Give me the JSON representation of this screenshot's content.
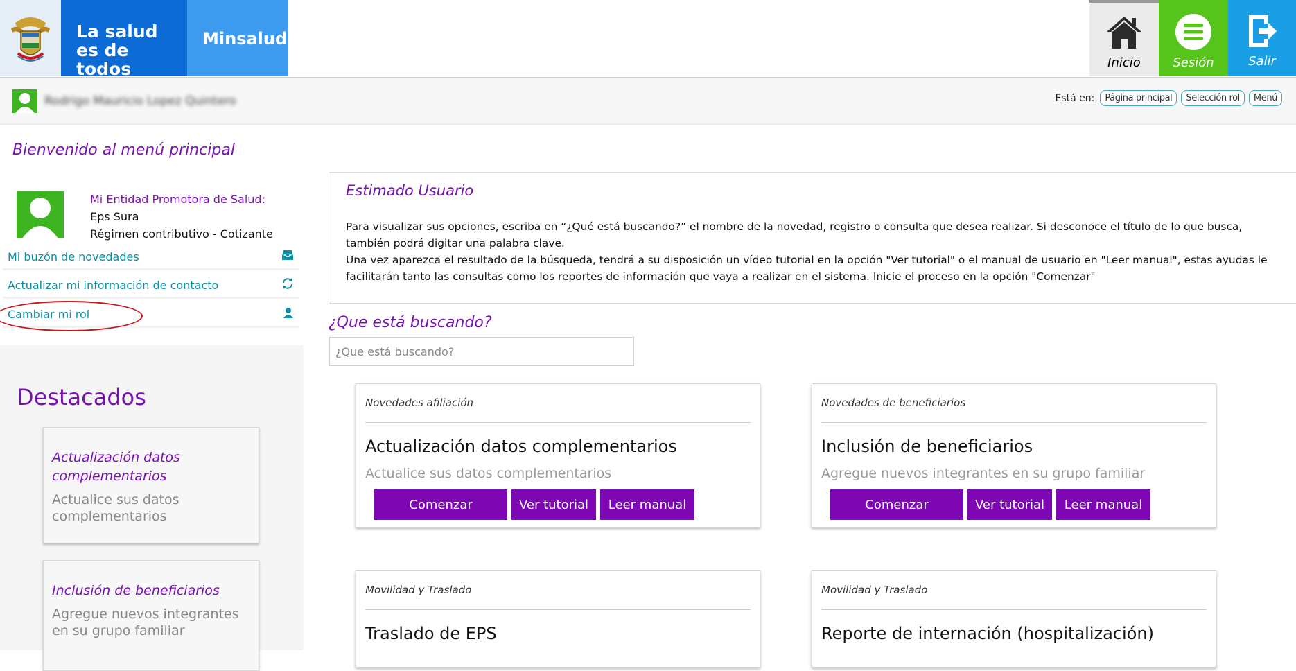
{
  "header": {
    "brand_line1": "La salud",
    "brand_line2": "es de todos",
    "brand_ministry": "Minsalud",
    "buttons": {
      "home": "Inicio",
      "session": "Sesión",
      "exit": "Salir"
    },
    "colors": {
      "blue": "#0d6bd6",
      "light_blue": "#3d9bf0",
      "green": "#57c41b",
      "exit_blue": "#1a9ee5"
    }
  },
  "userbar": {
    "user_name": "Rodrigo Mauricio Lopez Quintero",
    "breadcrumb_label": "Está en:",
    "breadcrumbs": [
      "Página principal",
      "Selección rol",
      "Menú"
    ]
  },
  "welcome": "Bienvenido al menú principal",
  "profile": {
    "eps_title": "Mi Entidad Promotora de Salud:",
    "eps_name": "Eps Sura",
    "regime": "Régimen contributivo - Cotizante",
    "links": [
      {
        "label": "Mi buzón de novedades",
        "icon": "inbox-icon"
      },
      {
        "label": "Actualizar mi información de contacto",
        "icon": "refresh-icon"
      },
      {
        "label": "Cambiar mi rol",
        "icon": "user-icon"
      }
    ]
  },
  "destacados": {
    "title": "Destacados",
    "items": [
      {
        "title": "Actualización datos complementarios",
        "desc": "Actualice sus datos complementarios"
      },
      {
        "title": "Inclusión de beneficiarios",
        "desc": "Agregue nuevos integrantes en su grupo familiar"
      }
    ]
  },
  "info": {
    "title": "Estimado Usuario",
    "p1": "Para visualizar sus opciones, escriba en “¿Qué está buscando?” el nombre de la novedad, registro o consulta que desea realizar. Si desconoce el título de lo que busca, también podrá digitar una palabra clave.",
    "p2": "Una vez aparezca el resultado de la búsqueda, tendrá a su disposición un vídeo tutorial en la opción \"Ver tutorial\" o el manual de usuario en \"Leer manual\", estas ayudas le facilitarán tanto las consultas como los reportes de información que vaya a realizar en el sistema. Inicie el proceso en la opción \"Comenzar\""
  },
  "search": {
    "label": "¿Que está buscando?",
    "placeholder": "¿Que está buscando?"
  },
  "cards": [
    {
      "category": "Novedades afiliación",
      "title": "Actualización datos complementarios",
      "desc": "Actualice sus datos complementarios"
    },
    {
      "category": "Novedades de beneficiarios",
      "title": "Inclusión de beneficiarios",
      "desc": "Agregue nuevos integrantes en su grupo familiar"
    },
    {
      "category": "Movilidad y Traslado",
      "title": "Traslado de EPS",
      "desc": ""
    },
    {
      "category": "Movilidad y Traslado",
      "title": "Reporte de internación (hospitalización)",
      "desc": ""
    }
  ],
  "card_buttons": {
    "start": "Comenzar",
    "tutorial": "Ver tutorial",
    "manual": "Leer manual"
  }
}
